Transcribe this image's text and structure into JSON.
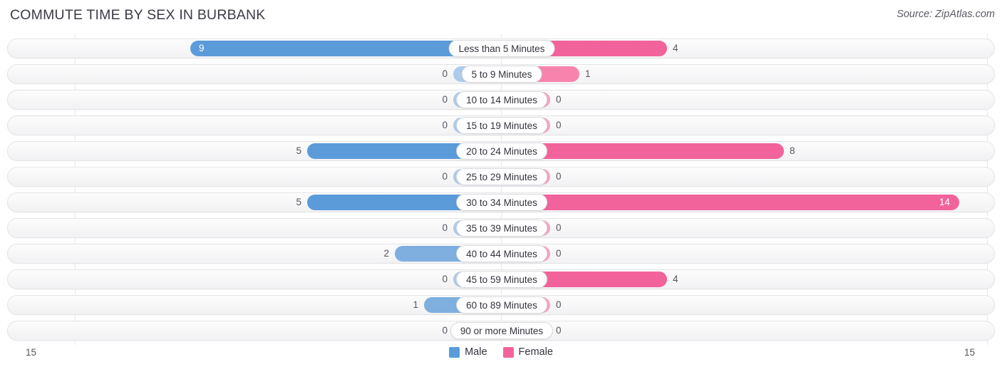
{
  "header": {
    "title": "COMMUTE TIME BY SEX IN BURBANK",
    "source": "Source: ZipAtlas.com"
  },
  "legend": {
    "male_label": "Male",
    "female_label": "Female",
    "male_color": "#5b9bd9",
    "female_color": "#f2639b"
  },
  "axis": {
    "left_label": "15",
    "right_label": "15"
  },
  "chart_data": {
    "type": "bar",
    "orientation": "horizontal-diverging",
    "title": "COMMUTE TIME BY SEX IN BURBANK",
    "subtitle": "Source: ZipAtlas.com",
    "xlabel": "",
    "ylabel": "",
    "xlim": [
      15,
      15
    ],
    "axis_left_max": 15,
    "axis_right_max": 15,
    "grid": false,
    "legend_position": "bottom-center",
    "categories": [
      "Less than 5 Minutes",
      "5 to 9 Minutes",
      "10 to 14 Minutes",
      "15 to 19 Minutes",
      "20 to 24 Minutes",
      "25 to 29 Minutes",
      "30 to 34 Minutes",
      "35 to 39 Minutes",
      "40 to 44 Minutes",
      "45 to 59 Minutes",
      "60 to 89 Minutes",
      "90 or more Minutes"
    ],
    "series": [
      {
        "name": "Male",
        "color": "#5b9bd9",
        "values": [
          9,
          0,
          0,
          0,
          5,
          0,
          5,
          0,
          2,
          0,
          1,
          0
        ]
      },
      {
        "name": "Female",
        "color": "#f2639b",
        "values": [
          4,
          1,
          0,
          0,
          8,
          0,
          14,
          0,
          0,
          4,
          0,
          0
        ]
      }
    ]
  }
}
